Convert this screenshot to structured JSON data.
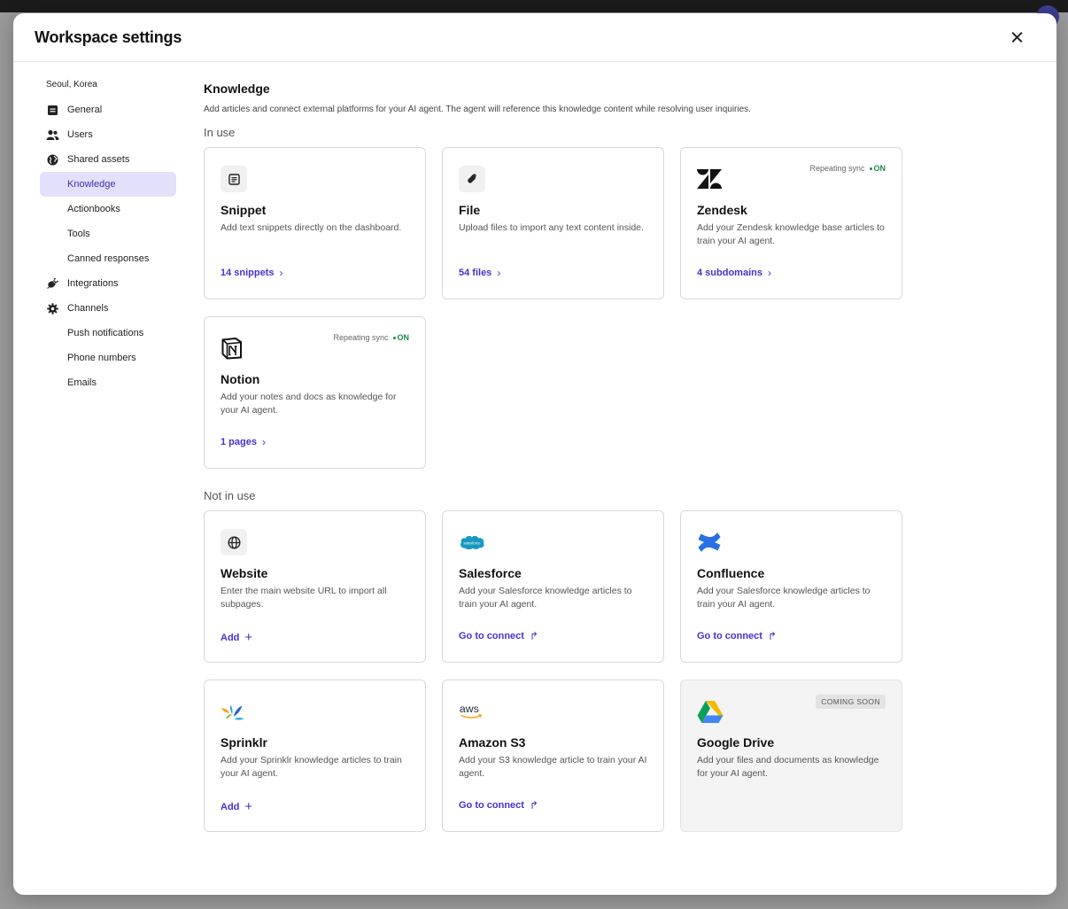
{
  "modal": {
    "title": "Workspace settings"
  },
  "sidebar": {
    "workspace": "Seoul, Korea",
    "items": [
      {
        "label": "General",
        "icon": "document-icon"
      },
      {
        "label": "Users",
        "icon": "users-icon"
      },
      {
        "label": "Shared assets",
        "icon": "globe-icon"
      },
      {
        "label": "Knowledge",
        "active": true
      },
      {
        "label": "Actionbooks"
      },
      {
        "label": "Tools"
      },
      {
        "label": "Canned responses"
      },
      {
        "label": "Integrations",
        "icon": "plug-icon"
      },
      {
        "label": "Channels",
        "icon": "gear-icon"
      },
      {
        "label": "Push notifications"
      },
      {
        "label": "Phone numbers"
      },
      {
        "label": "Emails"
      }
    ]
  },
  "main": {
    "title": "Knowledge",
    "description": "Add articles and connect external platforms for your AI agent. The agent will reference this knowledge content while resolving user inquiries.",
    "in_use": {
      "title": "In use",
      "cards": [
        {
          "title": "Snippet",
          "description": "Add text snippets directly on the dashboard.",
          "link": "14 snippets",
          "icon": "snippet-icon"
        },
        {
          "title": "File",
          "description": "Upload files to import any text content inside.",
          "link": "54 files",
          "icon": "paperclip-icon"
        },
        {
          "title": "Zendesk",
          "description": "Add your Zendesk knowledge base articles to train your AI agent.",
          "link": "4 subdomains",
          "icon": "zendesk-logo",
          "sync_label": "Repeating sync",
          "sync_status": "ON"
        },
        {
          "title": "Notion",
          "description": "Add your notes and docs as knowledge for your AI agent.",
          "link": "1 pages",
          "icon": "notion-logo",
          "sync_label": "Repeating sync",
          "sync_status": "ON"
        }
      ]
    },
    "not_in_use": {
      "title": "Not in use",
      "cards": [
        {
          "title": "Website",
          "description": "Enter the main website URL to import all subpages.",
          "link": "Add",
          "icon": "globe-icon"
        },
        {
          "title": "Salesforce",
          "description": "Add your Salesforce knowledge articles to train your AI agent.",
          "link": "Go to connect",
          "icon": "salesforce-logo",
          "logo_text": "salesforce"
        },
        {
          "title": "Confluence",
          "description": "Add your Salesforce knowledge articles to train your AI agent.",
          "link": "Go to connect",
          "icon": "confluence-logo"
        },
        {
          "title": "Sprinklr",
          "description": "Add your Sprinklr knowledge articles to train your AI agent.",
          "link": "Add",
          "icon": "sprinklr-logo"
        },
        {
          "title": "Amazon S3",
          "description": "Add your S3 knowledge article to train your AI agent.",
          "link": "Go to connect",
          "icon": "aws-logo",
          "logo_text": "aws"
        },
        {
          "title": "Google Drive",
          "description": "Add your files and documents as knowledge for your AI agent.",
          "icon": "google-drive-logo",
          "badge": "COMING SOON"
        }
      ]
    }
  },
  "colors": {
    "accent": "#4a2fd0",
    "active_bg": "#e2e0fb",
    "sync_on": "#1b8a4a"
  }
}
